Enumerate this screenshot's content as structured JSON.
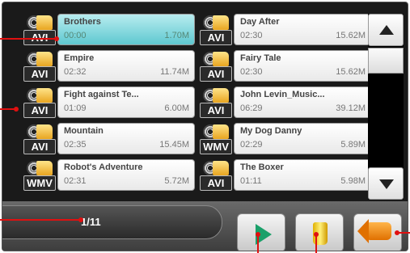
{
  "files": [
    {
      "left": {
        "title": "Brothers",
        "duration": "00:00",
        "size": "1.70M",
        "format": "AVI",
        "selected": true
      },
      "right": {
        "title": "Day After",
        "duration": "02:30",
        "size": "15.62M",
        "format": "AVI"
      }
    },
    {
      "left": {
        "title": "Empire",
        "duration": "02:32",
        "size": "11.74M",
        "format": "AVI"
      },
      "right": {
        "title": "Fairy Tale",
        "duration": "02:30",
        "size": "15.62M",
        "format": "AVI"
      }
    },
    {
      "left": {
        "title": "Fight against Te...",
        "duration": "01:09",
        "size": "6.00M",
        "format": "AVI"
      },
      "right": {
        "title": "John Levin_Music...",
        "duration": "06:29",
        "size": "39.12M",
        "format": "AVI"
      }
    },
    {
      "left": {
        "title": "Mountain",
        "duration": "02:35",
        "size": "15.45M",
        "format": "AVI"
      },
      "right": {
        "title": "My Dog Danny",
        "duration": "02:29",
        "size": "5.89M",
        "format": "WMV"
      }
    },
    {
      "left": {
        "title": "Robot's Adventure",
        "duration": "02:31",
        "size": "5.72M",
        "format": "WMV"
      },
      "right": {
        "title": "The Boxer",
        "duration": "01:11",
        "size": "5.98M",
        "format": "AVI"
      }
    }
  ],
  "pager": {
    "label": "1/11"
  },
  "buttons": {
    "play": "play-icon",
    "delete": "trash-icon",
    "back": "back-arrow-icon"
  },
  "colors": {
    "selected": "#5ec8d0",
    "marker": "#e01010",
    "play": "#1aa06a",
    "back": "#e07000"
  }
}
